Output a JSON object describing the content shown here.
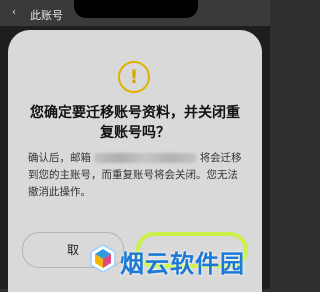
{
  "header": {
    "back_glyph": "‹",
    "title": "此账号"
  },
  "dialog": {
    "icon": "warning-icon",
    "title": "您确定要迁移账号资料，并关闭重复账号吗？",
    "body_prefix": "确认后，邮箱",
    "body_suffix": "将会迁移到您的主账号，而重复账号将会关闭。您无法撤消此操作。",
    "cancel_label": "取"
  },
  "watermark": {
    "text": "烟云软件园"
  },
  "colors": {
    "accent": "#ccf24a",
    "warning": "#e0b100",
    "dialog_bg": "#d9d9d9",
    "watermark": "#1c79d6"
  }
}
